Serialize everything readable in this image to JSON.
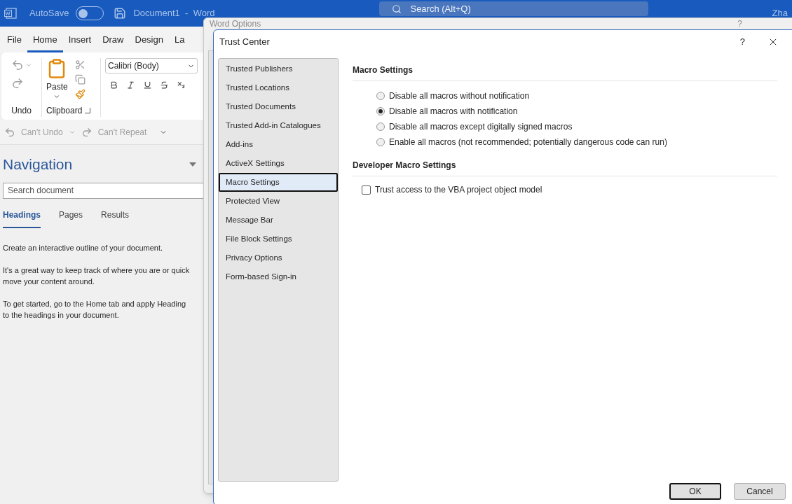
{
  "word_window": {
    "autosave_label": "AutoSave",
    "autosave_on": false,
    "document_title": "Document1  -  Word",
    "search_placeholder": "Search (Alt+Q)",
    "user_name": "Zha"
  },
  "ribbon_tabs": [
    {
      "label": "File",
      "selected": false
    },
    {
      "label": "Home",
      "selected": true
    },
    {
      "label": "Insert",
      "selected": false
    },
    {
      "label": "Draw",
      "selected": false
    },
    {
      "label": "Design",
      "selected": false
    },
    {
      "label": "La",
      "selected": false
    }
  ],
  "ribbon": {
    "undo_group": "Undo",
    "clipboard_group": "Clipboard",
    "paste_label": "Paste",
    "font_name": "Calibri (Body)"
  },
  "quick_access": {
    "undo": "Can't Undo",
    "repeat": "Can't Repeat"
  },
  "navigation": {
    "title": "Navigation",
    "search_placeholder": "Search document",
    "tabs": [
      {
        "label": "Headings",
        "selected": true
      },
      {
        "label": "Pages",
        "selected": false
      },
      {
        "label": "Results",
        "selected": false
      }
    ],
    "paragraphs": [
      [
        "Create an interactive outline of your document."
      ],
      [
        "It's a great way to keep track of where you are or quick",
        "move your content around."
      ],
      [
        "To get started, go to the Home tab and apply Heading",
        "to the headings in your document."
      ]
    ]
  },
  "word_options": {
    "title": "Word Options",
    "help": "?"
  },
  "trust_center": {
    "title": "Trust Center",
    "help": "?",
    "categories": [
      {
        "label": "Trusted Publishers",
        "selected": false
      },
      {
        "label": "Trusted Locations",
        "selected": false
      },
      {
        "label": "Trusted Documents",
        "selected": false
      },
      {
        "label": "Trusted Add-in Catalogues",
        "selected": false
      },
      {
        "label": "Add-ins",
        "selected": false
      },
      {
        "label": "ActiveX Settings",
        "selected": false
      },
      {
        "label": "Macro Settings",
        "selected": true
      },
      {
        "label": "Protected View",
        "selected": false
      },
      {
        "label": "Message Bar",
        "selected": false
      },
      {
        "label": "File Block Settings",
        "selected": false
      },
      {
        "label": "Privacy Options",
        "selected": false
      },
      {
        "label": "Form-based Sign-in",
        "selected": false
      }
    ],
    "macro_heading": "Macro Settings",
    "macro_options": [
      {
        "label": "Disable all macros without notification",
        "selected": false
      },
      {
        "label": "Disable all macros with notification",
        "selected": true
      },
      {
        "label": "Disable all macros except digitally signed macros",
        "selected": false
      },
      {
        "label": "Enable all macros (not recommended; potentially dangerous code can run)",
        "selected": false
      }
    ],
    "developer_heading": "Developer Macro Settings",
    "developer_options": [
      {
        "label": "Trust access to the VBA project object model",
        "checked": false
      }
    ],
    "buttons": [
      {
        "label": "OK",
        "default": true
      },
      {
        "label": "Cancel",
        "default": false
      }
    ]
  }
}
